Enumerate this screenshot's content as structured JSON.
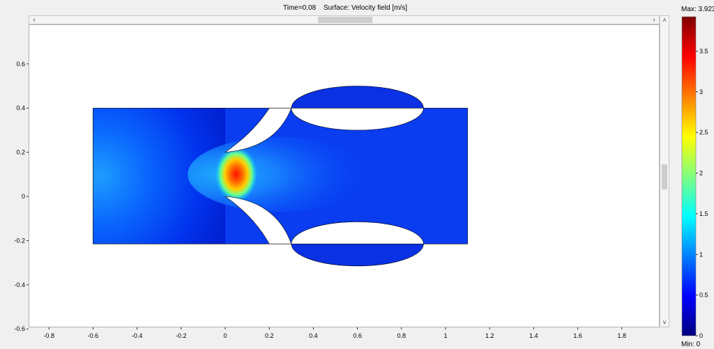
{
  "title": {
    "time": "Time=0.08",
    "surface": "Surface: Velocity field [m/s]"
  },
  "colorbar": {
    "max_label": "Max: 3.923",
    "min_label": "Min: 0",
    "max_value": 3.923,
    "min_value": 0,
    "ticks": [
      "3.5",
      "3",
      "2.5",
      "2",
      "1.5",
      "1",
      "0.5",
      "0"
    ],
    "colormap": [
      "#00007f",
      "#0000ff",
      "#007fff",
      "#00ffff",
      "#7fff7f",
      "#ffff00",
      "#ff7f00",
      "#ff0000",
      "#7f0000"
    ]
  },
  "chart_data": {
    "type": "heatmap",
    "title": "Time=0.08   Surface: Velocity field [m/s]",
    "xlabel": "",
    "ylabel": "",
    "xlim": [
      -0.9,
      2.0
    ],
    "ylim": [
      -0.6,
      0.75
    ],
    "x_ticks": [
      "-0.8",
      "-0.6",
      "-0.4",
      "-0.2",
      "0",
      "0.2",
      "0.4",
      "0.6",
      "0.8",
      "1",
      "1.2",
      "1.4",
      "1.6",
      "1.8"
    ],
    "y_ticks": [
      "0.6",
      "0.4",
      "0.2",
      "0",
      "-0.2",
      "-0.4",
      "-0.6"
    ],
    "geometry": {
      "channel": {
        "x": [
          -0.6,
          1.1
        ],
        "y": [
          -0.215,
          0.4
        ]
      },
      "upper_ellipse": {
        "cx": 0.6,
        "cy": 0.4,
        "rx": 0.3,
        "ry": 0.1
      },
      "lower_ellipse": {
        "cx": 0.6,
        "cy": -0.215,
        "rx": 0.3,
        "ry": 0.1
      },
      "valve_leaflet_tips": [
        [
          0.0,
          0.2
        ],
        [
          0.0,
          0.0
        ]
      ]
    },
    "max_velocity": 3.923,
    "min_velocity": 0,
    "jet_region": {
      "x": [
        0.0,
        0.1
      ],
      "y": [
        0.0,
        0.2
      ],
      "peak_velocity": 3.9
    },
    "bulk_velocity_approx": 0.4
  }
}
